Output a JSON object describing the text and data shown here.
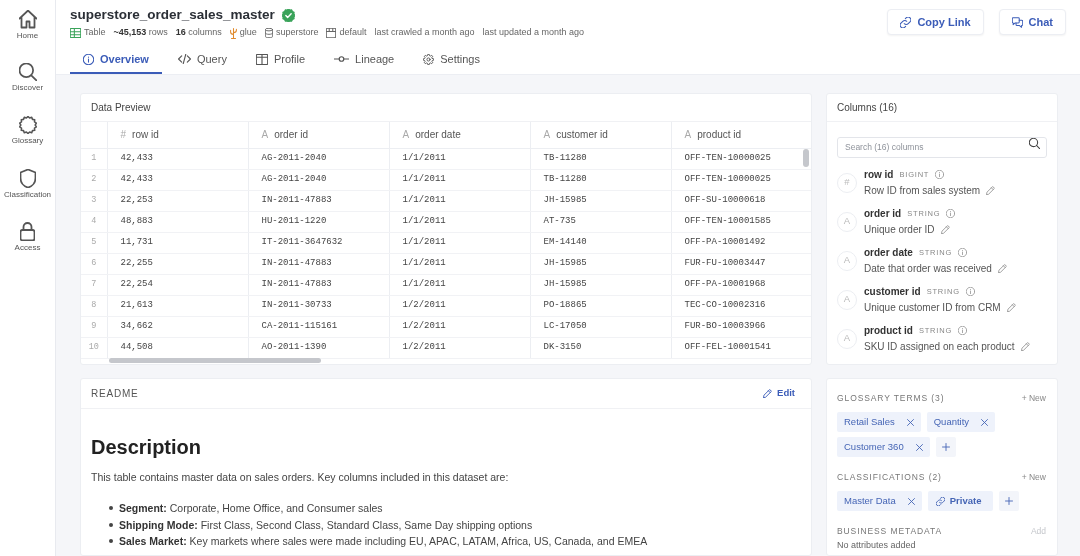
{
  "sidebar": {
    "items": [
      {
        "label": "Home",
        "selected": false
      },
      {
        "label": "Discover",
        "selected": false
      },
      {
        "label": "Glossary",
        "selected": false
      },
      {
        "label": "Classification",
        "selected": false
      },
      {
        "label": "Access",
        "selected": false
      }
    ]
  },
  "header": {
    "title": "superstore_order_sales_master",
    "verified": true,
    "meta": [
      {
        "kind": "type",
        "text": "Table"
      },
      {
        "kind": "count",
        "text": "**~45,153** rows"
      },
      {
        "kind": "count",
        "text": "**16** columns"
      },
      {
        "kind": "source",
        "text": "glue"
      },
      {
        "kind": "database",
        "text": "superstore"
      },
      {
        "kind": "schema",
        "text": "default"
      },
      {
        "kind": "time",
        "text": "last crawled a month ago"
      },
      {
        "kind": "time",
        "text": "last updated a month ago"
      }
    ],
    "actions": [
      {
        "label": "Copy Link"
      },
      {
        "label": "Chat"
      }
    ]
  },
  "tabs": [
    {
      "label": "Overview",
      "selected": true
    },
    {
      "label": "Query",
      "selected": false
    },
    {
      "label": "Profile",
      "selected": false
    },
    {
      "label": "Lineage",
      "selected": false
    },
    {
      "label": "Settings",
      "selected": false
    }
  ],
  "data_preview": {
    "title": "Data Preview",
    "columns": [
      {
        "glyph": "#",
        "name": "row id"
      },
      {
        "glyph": "A",
        "name": "order id"
      },
      {
        "glyph": "A",
        "name": "order date"
      },
      {
        "glyph": "A",
        "name": "customer id"
      },
      {
        "glyph": "A",
        "name": "product id"
      }
    ],
    "rows": [
      {
        "number": "1",
        "cells": [
          "42,433",
          "AG-2011-2040",
          "1/1/2011",
          "TB-11280",
          "OFF-TEN-10000025"
        ]
      },
      {
        "number": "2",
        "cells": [
          "42,433",
          "AG-2011-2040",
          "1/1/2011",
          "TB-11280",
          "OFF-TEN-10000025"
        ]
      },
      {
        "number": "3",
        "cells": [
          "22,253",
          "IN-2011-47883",
          "1/1/2011",
          "JH-15985",
          "OFF-SU-10000618"
        ]
      },
      {
        "number": "4",
        "cells": [
          "48,883",
          "HU-2011-1220",
          "1/1/2011",
          "AT-735",
          "OFF-TEN-10001585"
        ]
      },
      {
        "number": "5",
        "cells": [
          "11,731",
          "IT-2011-3647632",
          "1/1/2011",
          "EM-14140",
          "OFF-PA-10001492"
        ]
      },
      {
        "number": "6",
        "cells": [
          "22,255",
          "IN-2011-47883",
          "1/1/2011",
          "JH-15985",
          "FUR-FU-10003447"
        ]
      },
      {
        "number": "7",
        "cells": [
          "22,254",
          "IN-2011-47883",
          "1/1/2011",
          "JH-15985",
          "OFF-PA-10001968"
        ]
      },
      {
        "number": "8",
        "cells": [
          "21,613",
          "IN-2011-30733",
          "1/2/2011",
          "PO-18865",
          "TEC-CO-10002316"
        ]
      },
      {
        "number": "9",
        "cells": [
          "34,662",
          "CA-2011-115161",
          "1/2/2011",
          "LC-17050",
          "FUR-BO-10003966"
        ]
      },
      {
        "number": "10",
        "cells": [
          "44,508",
          "AO-2011-1390",
          "1/2/2011",
          "DK-3150",
          "OFF-FEL-10001541"
        ]
      }
    ]
  },
  "columns_panel": {
    "title": "Columns (16)",
    "search": {
      "placeholder": "Search (16) columns"
    },
    "items": [
      {
        "glyph": "#",
        "name": "row id",
        "type": "BIGINT",
        "description": "Row ID from sales system"
      },
      {
        "glyph": "A",
        "name": "order id",
        "type": "STRING",
        "description": "Unique order ID"
      },
      {
        "glyph": "A",
        "name": "order date",
        "type": "STRING",
        "description": "Date that order was received"
      },
      {
        "glyph": "A",
        "name": "customer id",
        "type": "STRING",
        "description": "Unique customer ID from CRM"
      },
      {
        "glyph": "A",
        "name": "product id",
        "type": "STRING",
        "description": "SKU ID assigned on each product"
      }
    ]
  },
  "readme": {
    "title": "README",
    "edit_label": "Edit",
    "heading": "Description",
    "paragraph": "This table contains master data on sales orders. Key columns included in this dataset are:",
    "bullets": [
      "**Segment:** Corporate, Home Office, and Consumer sales",
      "**Shipping Mode:** First Class, Second Class, Standard Class, Same Day shipping options",
      "**Sales Market:** Key markets where sales were made including EU, APAC, LATAM, Africa, US, Canada, and EMEA"
    ]
  },
  "metadata_panel": {
    "sections": [
      {
        "title": "GLOSSARY TERMS (3)",
        "action": "+ New",
        "action_disabled": false,
        "tags": [
          {
            "label": "Retail Sales",
            "kind": "removable"
          },
          {
            "label": "Quantity",
            "kind": "removable"
          },
          {
            "label": "Customer 360",
            "kind": "removable"
          }
        ],
        "can_add": true
      },
      {
        "title": "CLASSIFICATIONS (2)",
        "action": "+ New",
        "action_disabled": false,
        "tags": [
          {
            "label": "Master Data",
            "kind": "removable"
          },
          {
            "label": "Private",
            "kind": "linked"
          }
        ],
        "can_add": true
      },
      {
        "title": "BUSINESS METADATA",
        "action": "Add",
        "action_disabled": true,
        "empty_text": "No attributes added"
      }
    ]
  }
}
